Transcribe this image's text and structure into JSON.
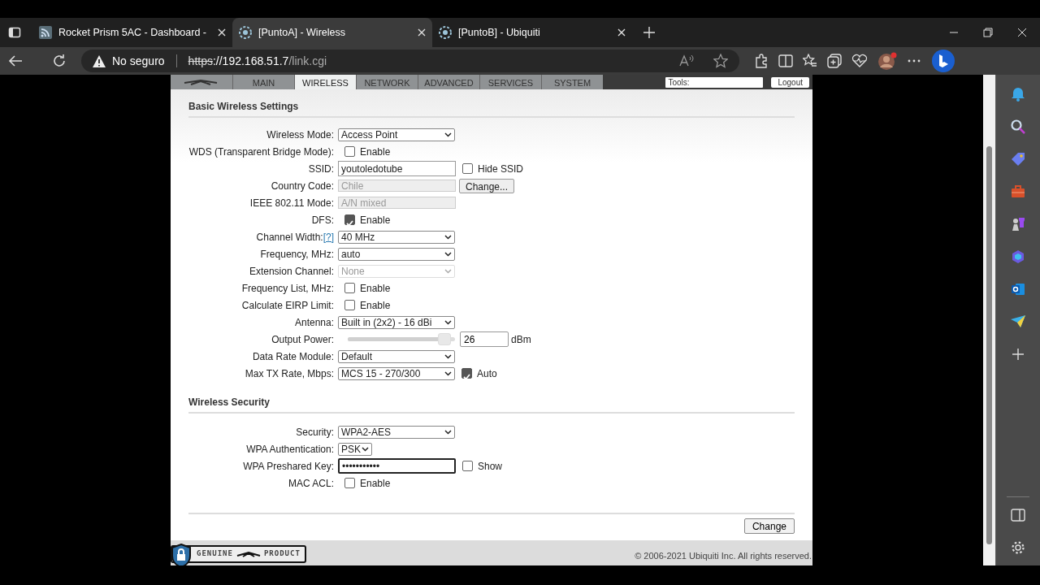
{
  "browser_tabs": [
    {
      "title": "Rocket Prism 5AC - Dashboard -",
      "selected": false
    },
    {
      "title": "[PuntoA] - Wireless",
      "selected": true
    },
    {
      "title": "[PuntoB] - Ubiquiti",
      "selected": false
    }
  ],
  "address_bar": {
    "security": "No seguro",
    "url_scheme": "https",
    "url_host": "://192.168.51.7",
    "url_path": "/link.cgi"
  },
  "device_nav": {
    "tabs": [
      {
        "label": "MAIN",
        "selected": false
      },
      {
        "label": "WIRELESS",
        "selected": true
      },
      {
        "label": "NETWORK",
        "selected": false
      },
      {
        "label": "ADVANCED",
        "selected": false
      },
      {
        "label": "SERVICES",
        "selected": false
      },
      {
        "label": "SYSTEM",
        "selected": false
      }
    ],
    "tools_label": "Tools:",
    "logout": "Logout"
  },
  "sections": [
    {
      "title": "Basic Wireless Settings",
      "rows": [
        {
          "label": "Wireless Mode:",
          "kind": "select",
          "value": "Access Point"
        },
        {
          "label": "WDS (Transparent Bridge Mode):",
          "kind": "checkbox",
          "text": "Enable",
          "checked": false
        },
        {
          "label": "SSID:",
          "kind": "text",
          "value": "youtoledotube",
          "extra": {
            "kind": "checkbox",
            "text": "Hide SSID",
            "checked": false
          }
        },
        {
          "label": "Country Code:",
          "kind": "readonly",
          "value": "Chile",
          "extra": {
            "kind": "button",
            "text": "Change..."
          }
        },
        {
          "label": "IEEE 802.11 Mode:",
          "kind": "readonly",
          "value": "A/N mixed"
        },
        {
          "label": "DFS:",
          "kind": "checkbox",
          "text": "Enable",
          "checked": true
        },
        {
          "label": "Channel Width:",
          "help": "[?]",
          "kind": "select",
          "value": "40 MHz"
        },
        {
          "label": "Frequency, MHz:",
          "kind": "select",
          "value": "auto"
        },
        {
          "label": "Extension Channel:",
          "kind": "select",
          "value": "None",
          "disabled": true
        },
        {
          "label": "Frequency List, MHz:",
          "kind": "checkbox",
          "text": "Enable",
          "checked": false
        },
        {
          "label": "Calculate EIRP Limit:",
          "kind": "checkbox",
          "text": "Enable",
          "checked": false
        },
        {
          "label": "Antenna:",
          "kind": "select",
          "value": "Built in (2x2) - 16 dBi"
        },
        {
          "label": "Output Power:",
          "kind": "slider",
          "level": 0.9,
          "value": "26",
          "unit": "dBm"
        },
        {
          "label": "Data Rate Module:",
          "kind": "select",
          "value": "Default"
        },
        {
          "label": "Max TX Rate, Mbps:",
          "kind": "select",
          "value": "MCS 15 - 270/300",
          "extra": {
            "kind": "checkbox",
            "text": "Auto",
            "checked": true
          }
        }
      ]
    },
    {
      "title": "Wireless Security",
      "rows": [
        {
          "label": "Security:",
          "kind": "select",
          "value": "WPA2-AES"
        },
        {
          "label": "WPA Authentication:",
          "kind": "compact_select",
          "value": "PSK"
        },
        {
          "label": "WPA Preshared Key:",
          "kind": "password",
          "value": "•••••••••••",
          "focused": true,
          "extra": {
            "kind": "checkbox",
            "text": "Show",
            "checked": false
          }
        },
        {
          "label": "MAC ACL:",
          "kind": "checkbox",
          "text": "Enable",
          "checked": false
        }
      ]
    }
  ],
  "submit": "Change",
  "footer": {
    "badge_left": "GENUINE",
    "badge_right": "PRODUCT",
    "copyright": "© 2006-2021 Ubiquiti Inc. All rights reserved."
  }
}
